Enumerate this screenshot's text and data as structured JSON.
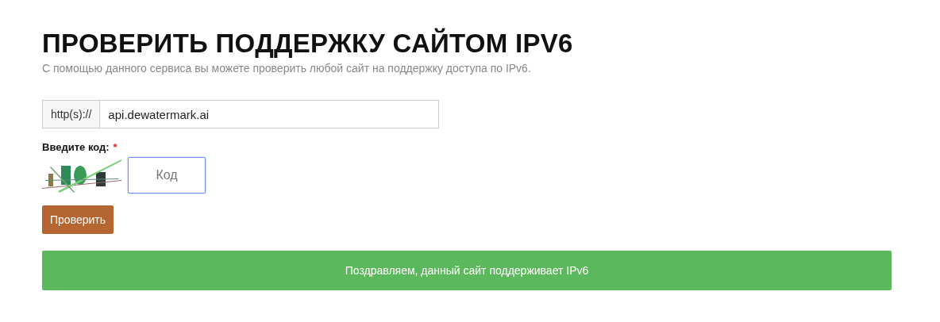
{
  "title": "ПРОВЕРИТЬ ПОДДЕРЖКУ САЙТОМ IPV6",
  "subtitle": "С помощью данного сервиса вы можете проверить любой сайт на поддержку доступа по IPv6.",
  "url_field": {
    "prefix": "http(s)://",
    "value": "api.dewatermark.ai"
  },
  "captcha": {
    "label": "Введите код:",
    "required_mark": "*",
    "field": {
      "placeholder": "Код",
      "focused": true
    }
  },
  "submit_button": "Проверить",
  "result": {
    "text": "Поздравляем, данный сайт поддерживает IPv6",
    "kind": "success"
  }
}
